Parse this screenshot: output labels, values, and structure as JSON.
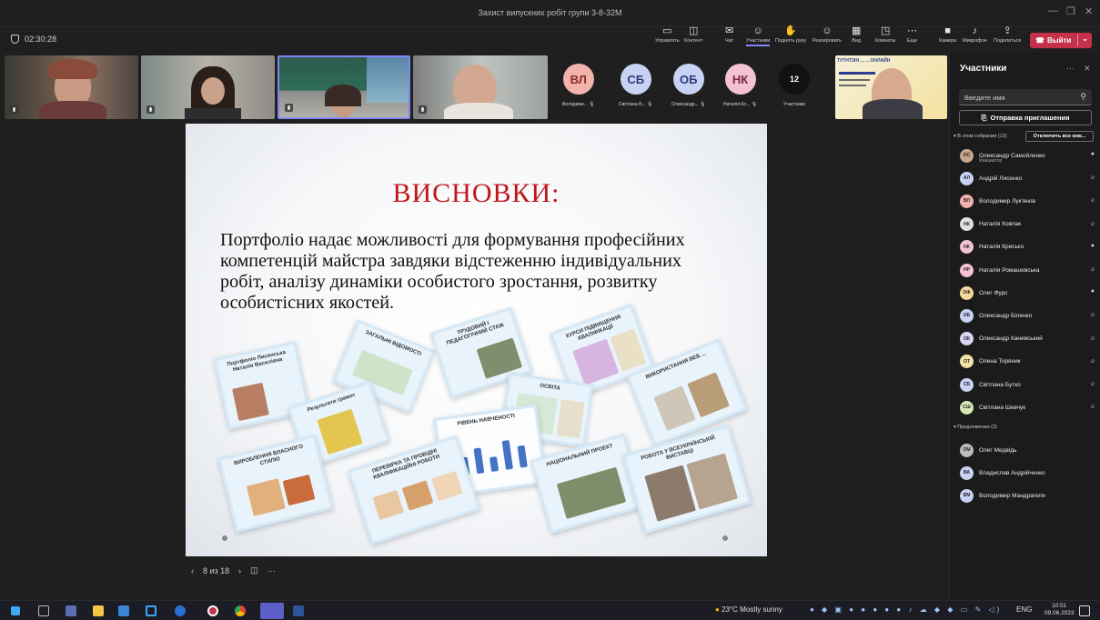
{
  "window": {
    "title": "Захист випускних робіт групи 3-8-32М",
    "minimize": "—",
    "restore": "❐",
    "close": "✕"
  },
  "toolbar": {
    "timer": "02:30:28",
    "buttons": [
      {
        "label": "Управлять",
        "icon": "share-tray-icon",
        "glyph": "▭"
      },
      {
        "label": "Контент",
        "icon": "content-icon",
        "glyph": "◫"
      },
      {
        "label": "Чат",
        "icon": "chat-icon",
        "glyph": "✉"
      },
      {
        "label": "Участники",
        "icon": "people-icon",
        "glyph": "☺"
      },
      {
        "label": "Поднять руку",
        "icon": "hand-icon",
        "glyph": "✋"
      },
      {
        "label": "Реагировать",
        "icon": "react-icon",
        "glyph": "☺"
      },
      {
        "label": "Вид",
        "icon": "view-icon",
        "glyph": "▦"
      },
      {
        "label": "Комнаты",
        "icon": "rooms-icon",
        "glyph": "◳"
      },
      {
        "label": "Еще",
        "icon": "more-icon",
        "glyph": "⋯"
      },
      {
        "label": "Камера",
        "icon": "camera-icon",
        "glyph": "■"
      },
      {
        "label": "Микрофон",
        "icon": "microphone-icon",
        "glyph": "♪"
      },
      {
        "label": "Поделиться",
        "icon": "share-icon",
        "glyph": "⇪"
      }
    ],
    "leave_label": "Выйти"
  },
  "strip": {
    "avatars": [
      {
        "initials": "ВЛ",
        "name": "Володими...",
        "color": "#f2b3ad"
      },
      {
        "initials": "СБ",
        "name": "Світлана Б...",
        "color": "#c8d3f3"
      },
      {
        "initials": "ОБ",
        "name": "Олександр...",
        "color": "#c8d3f3"
      },
      {
        "initials": "НК",
        "name": "Наталія Ко...",
        "color": "#f3c2d4"
      }
    ],
    "more_count": "12",
    "more_label": "Участники",
    "shared_banner": "ТУТНТЗНІ ... ... ОНЛАЙН"
  },
  "slide": {
    "title": "ВИСНОВКИ:",
    "text": "Портфоліо надає можливості для формування професійних компетенцій майстра завдяки відстеженню індивідуальних робіт, аналізу динаміки особистого зростання, розвитку особистісних якостей.",
    "thumbs": [
      {
        "title": "Портфоліо Лисянська Наталія Василівна"
      },
      {
        "title": "ЗАГАЛЬНІ ВІДОМОСТІ"
      },
      {
        "title": "ТРУДОВИЙ І ПЕДАГОГІЧНИЙ СТАЖ"
      },
      {
        "title": "КУРСИ ПІДВИЩЕННЯ КВАЛІФІКАЦІЇ"
      },
      {
        "title": "ВИКОРИСТАННЯ ВЕБ ..."
      },
      {
        "title": "Результати грамот"
      },
      {
        "title": "ОСВІТА"
      },
      {
        "title": "РІВЕНЬ НАВЧЕНОСТІ"
      },
      {
        "title": "ВИРОБЛЕННЯ ВЛАСНОГО СТИЛЮ"
      },
      {
        "title": "ПЕРЕВІРКА ТА ПРОВІДНІ КВАЛІФІКАЦІЙНІ РОБОТИ"
      },
      {
        "title": "НАЦІОНАЛЬНИЙ ПРОЕКТ"
      },
      {
        "title": "РОБОТА У ВСЕУКРАЇНСЬКІЙ ВИСТАВЦІ"
      }
    ]
  },
  "slidenav": {
    "counter": "8 из 18",
    "prev": "‹",
    "next": "›",
    "grid": "◫",
    "more": "···"
  },
  "panel": {
    "title": "Участники",
    "search_placeholder": "Введите имя",
    "invite_label": "Отправка приглашения",
    "in_meeting_label": "В этом собрании (12)",
    "mute_all_label": "Отключить все мик...",
    "organizer_label": "Инициатор",
    "participants": [
      {
        "initials": "ОС",
        "name": "Олександр Самойленко",
        "color": "#c9a58a",
        "mic": "on",
        "organizer": true
      },
      {
        "initials": "АЛ",
        "name": "Андрій Лисенко",
        "color": "#c8d3f3",
        "mic": "off"
      },
      {
        "initials": "ВЛ",
        "name": "Володимир Лук'янов",
        "color": "#f2b3ad",
        "mic": "off"
      },
      {
        "initials": "НК",
        "name": "Наталія Ковпак",
        "color": "#e0e0e0",
        "mic": "off"
      },
      {
        "initials": "НК",
        "name": "Наталія Крисько",
        "color": "#f3c2d4",
        "mic": "on"
      },
      {
        "initials": "НР",
        "name": "Наталія Ромашевська",
        "color": "#f3c2d4",
        "mic": "off"
      },
      {
        "initials": "ОФ",
        "name": "Олег Фурс",
        "color": "#f4d99b",
        "mic": "on"
      },
      {
        "initials": "ОБ",
        "name": "Олександр Біленко",
        "color": "#c8d3f3",
        "mic": "off"
      },
      {
        "initials": "ОК",
        "name": "Олександр Каневський",
        "color": "#d9d2f0",
        "mic": "off"
      },
      {
        "initials": "ОТ",
        "name": "Олена Торяник",
        "color": "#f0e3a6",
        "mic": "off"
      },
      {
        "initials": "СБ",
        "name": "Світлана Бутко",
        "color": "#c8d3f3",
        "mic": "off"
      },
      {
        "initials": "СШ",
        "name": "Світлана Шевчук",
        "color": "#d6e8b4",
        "mic": "off"
      }
    ],
    "suggested_label": "Предложения (3)",
    "suggested": [
      {
        "initials": "ОМ",
        "name": "Олег Медвідь",
        "color": "#bdbdbd"
      },
      {
        "initials": "ВА",
        "name": "Владислав Андрійченко",
        "color": "#c8d3f3"
      },
      {
        "initials": "ВМ",
        "name": "Володимир Мандрагеля",
        "color": "#c8d3f3"
      }
    ]
  },
  "taskbar": {
    "weather": "23°C  Mostly sunny",
    "lang": "ENG",
    "time": "10:51",
    "date": "09.06.2023"
  }
}
